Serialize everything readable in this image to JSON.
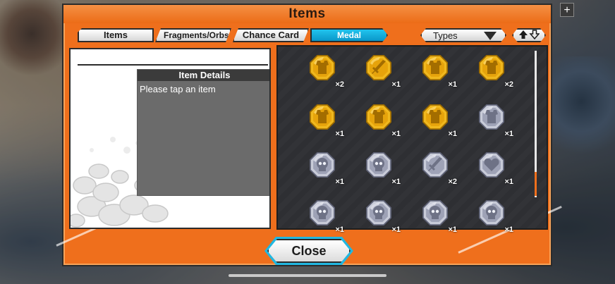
{
  "dialog": {
    "title": "Items",
    "accent_color": "#ef6f1c",
    "selected_tab_color": "#0a97c8"
  },
  "tabs": [
    {
      "label": "Items",
      "selected": false
    },
    {
      "label": "Fragments/Orbs",
      "selected": false
    },
    {
      "label": "Chance Card",
      "selected": false
    },
    {
      "label": "Medal Materials",
      "selected": true
    }
  ],
  "filter": {
    "types_label": "Types",
    "types_icon": "triangle-down-icon",
    "sort_icons": [
      "arrow-up-icon",
      "arrow-down-icon"
    ]
  },
  "detail": {
    "header": "Item Details",
    "placeholder": "Please tap an item"
  },
  "medals": [
    {
      "metal": "gold",
      "icon": "vest-icon",
      "qty": "×2"
    },
    {
      "metal": "gold",
      "icon": "sword-icon",
      "qty": "×1"
    },
    {
      "metal": "gold",
      "icon": "vest-icon",
      "qty": "×1"
    },
    {
      "metal": "gold",
      "icon": "vest-icon",
      "qty": "×2"
    },
    {
      "metal": "gold",
      "icon": "vest-icon",
      "qty": "×1"
    },
    {
      "metal": "gold",
      "icon": "vest-icon",
      "qty": "×1"
    },
    {
      "metal": "gold",
      "icon": "vest-icon",
      "qty": "×1"
    },
    {
      "metal": "silver",
      "icon": "vest-icon",
      "qty": "×1"
    },
    {
      "metal": "silver",
      "icon": "skull-icon",
      "qty": "×1"
    },
    {
      "metal": "silver",
      "icon": "skull-icon",
      "qty": "×1"
    },
    {
      "metal": "silver",
      "icon": "sword-icon",
      "qty": "×2"
    },
    {
      "metal": "silver",
      "icon": "heart-icon",
      "qty": "×1"
    },
    {
      "metal": "silver",
      "icon": "skull-icon",
      "qty": "×1"
    },
    {
      "metal": "silver",
      "icon": "skull-icon",
      "qty": "×1"
    },
    {
      "metal": "silver",
      "icon": "skull-icon",
      "qty": "×1"
    },
    {
      "metal": "silver",
      "icon": "skull-icon",
      "qty": "×1"
    }
  ],
  "footer": {
    "close_label": "Close"
  }
}
